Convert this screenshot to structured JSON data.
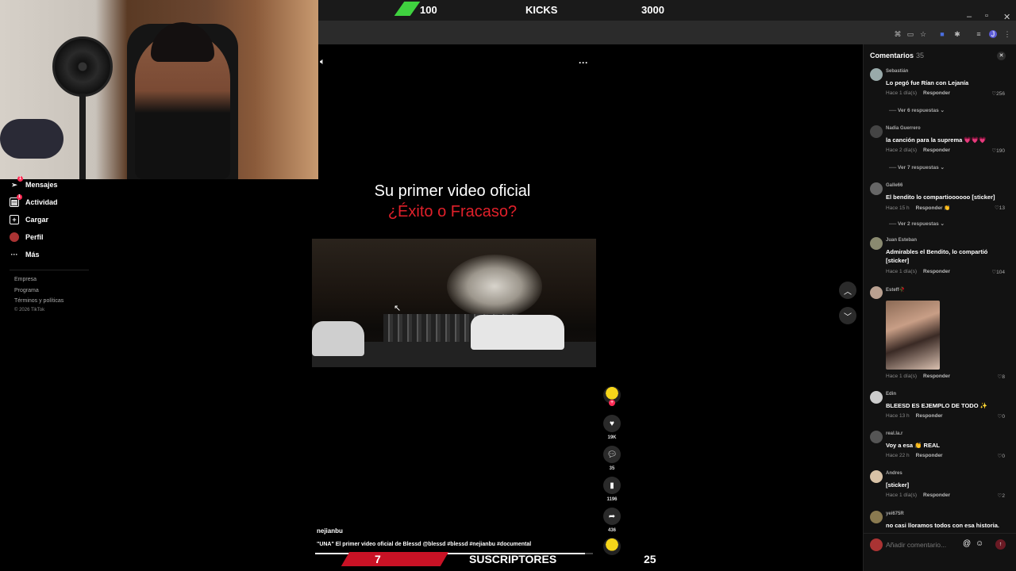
{
  "stream_overlay": {
    "kicks_count": "100",
    "kicks_label": "KICKS",
    "kicks_goal": "3000",
    "subs_count": "7",
    "subs_label": "SUSCRIPTORES",
    "subs_goal": "25"
  },
  "window_controls": {
    "minimize": "–",
    "restore": "▫",
    "close": "✕"
  },
  "sidebar": {
    "items": [
      {
        "label": "Mensajes",
        "icon": "send-icon",
        "badge": "1"
      },
      {
        "label": "Actividad",
        "icon": "inbox-icon",
        "badge": "1"
      },
      {
        "label": "Cargar",
        "icon": "upload-icon"
      },
      {
        "label": "Perfil",
        "icon": "profile-avatar"
      },
      {
        "label": "Más",
        "icon": "more-dots-icon"
      }
    ],
    "footer": [
      "Empresa",
      "Programa",
      "Términos y políticas",
      "© 2026 TikTok"
    ]
  },
  "video": {
    "title": "Su primer video oficial",
    "subtitle": "¿Éxito o Fracaso?",
    "author": "nejianbu",
    "caption": "\"UNA\" El primer video oficial de Blessd @blessd #blessd #nejianbu #documental",
    "progress": 0.97,
    "likes": "19K",
    "comments": "35",
    "saves": "1196",
    "shares": "436"
  },
  "comments_panel": {
    "title": "Comentarios",
    "count": "35",
    "reply_label": "Responder",
    "input_placeholder": "Añadir comentario...",
    "comments": [
      {
        "user": "Sebastián",
        "text": "Lo pegó fue Rían con Lejanía",
        "time": "Hace 1 día(s)",
        "likes": "256",
        "replies": "Ver 6 respuestas"
      },
      {
        "user": "Nadia Guerrero",
        "text": "la canción para la suprema 💗💗💗",
        "time": "Hace 2 día(s)",
        "likes": "190",
        "replies": "Ver 7 respuestas"
      },
      {
        "user": "Galle66",
        "text": "El bendito lo compartioooooo [sticker]",
        "time": "Hace 15 h",
        "likes": "13",
        "replies": "Ver 2 respuestas",
        "extra": "👏"
      },
      {
        "user": "Juan Esteban",
        "text": "Admirables el Bendito, lo compartió [sticker]",
        "time": "Hace 1 día(s)",
        "likes": "104"
      },
      {
        "user": "Esteff🥀",
        "text": "",
        "time": "Hace 1 día(s)",
        "likes": "8"
      },
      {
        "user": "Edin",
        "text": "BLEESD ES EJEMPLO DE TODO ✨",
        "time": "Hace 13 h",
        "likes": "0"
      },
      {
        "user": "real.la.r",
        "text": "Voy a esa 👏 REAL",
        "time": "Hace 22 h",
        "likes": "0"
      },
      {
        "user": "Andres",
        "text": "[sticker]",
        "time": "Hace 1 día(s)",
        "likes": "2"
      },
      {
        "user": "yei675R",
        "text": "no casi lloramos todos con esa historia.",
        "time": "",
        "likes": ""
      }
    ]
  }
}
